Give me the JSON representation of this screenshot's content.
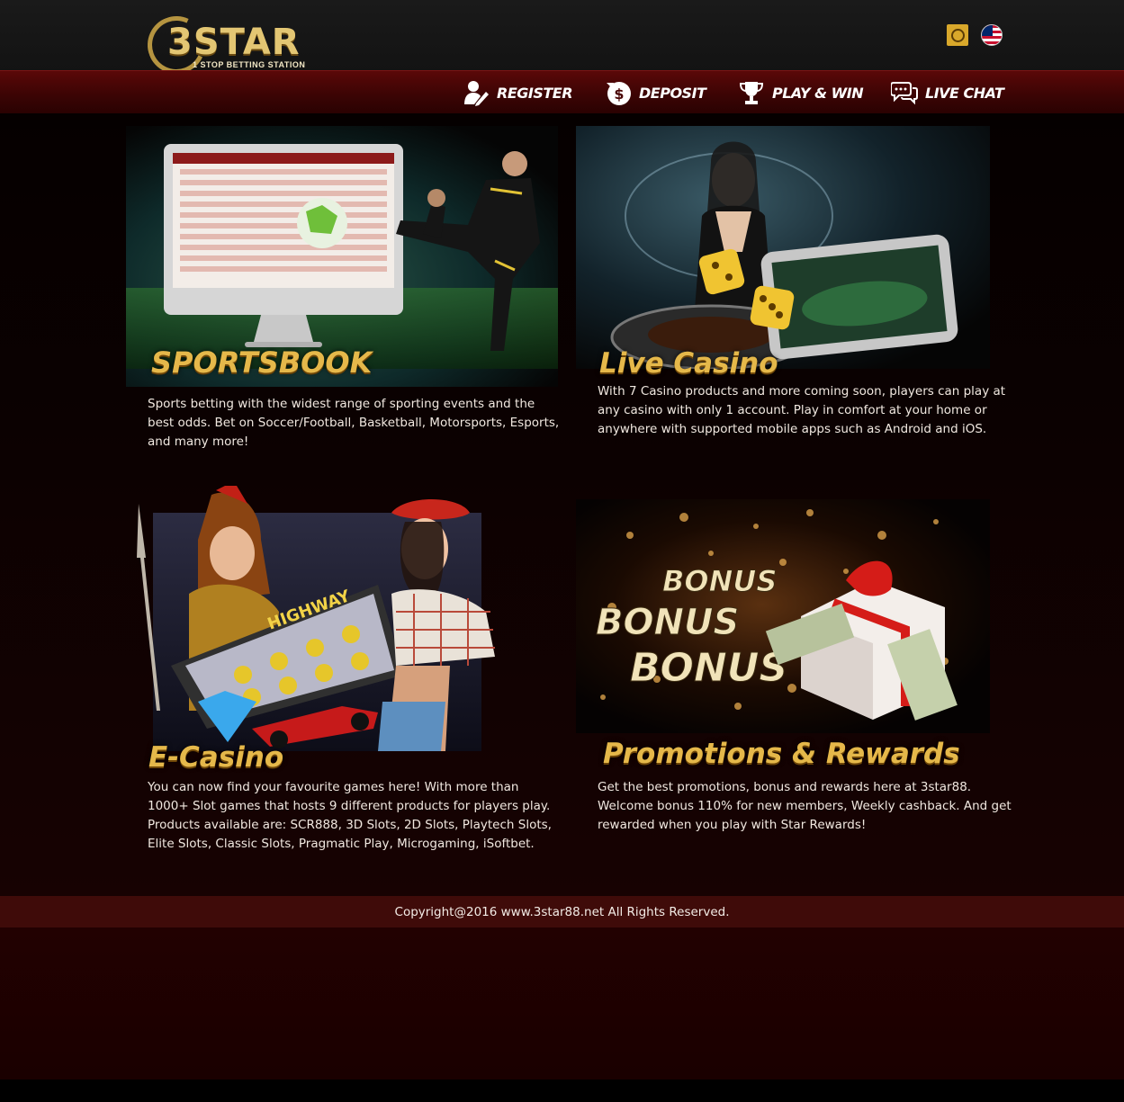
{
  "brand": {
    "logo_word": "3STAR",
    "tagline": "1 STOP BETTING STATION"
  },
  "languages": [
    {
      "name": "chinese-language-icon"
    },
    {
      "name": "malaysia-flag-icon"
    }
  ],
  "nav": {
    "items": [
      {
        "label": "REGISTER",
        "icon": "user-pen-icon"
      },
      {
        "label": "DEPOSIT",
        "icon": "money-bag-icon"
      },
      {
        "label": "PLAY & WIN",
        "icon": "trophy-icon"
      },
      {
        "label": "LIVE CHAT",
        "icon": "chat-bubbles-icon"
      }
    ]
  },
  "sections": {
    "sportsbook": {
      "title": "SPORTSBOOK",
      "text": "Sports betting with the widest range of sporting events and the best odds. Bet on Soccer/Football, Basketball, Motorsports, Esports, and many more!"
    },
    "live_casino": {
      "title": "Live Casino",
      "text": "With 7 Casino products and more coming soon, players can play at any casino with only 1 account. Play in comfort at your home or anywhere with supported mobile apps such as Android and iOS."
    },
    "ecasino": {
      "title": "E-Casino",
      "art_label": "HIGHWAY",
      "text": "You can now find your favourite games here! With more than 1000+ Slot games that hosts 9 different products for players play. Products available are: SCR888, 3D Slots, 2D Slots, Playtech Slots, Elite Slots, Classic Slots, Pragmatic Play, Microgaming, iSoftbet."
    },
    "promotions": {
      "title": "Promotions & Rewards",
      "art_words": [
        "BONUS",
        "BONUS",
        "BONUS"
      ],
      "text": "Get the best promotions, bonus and rewards here at 3star88. Welcome bonus 110% for new members, Weekly cashback. And get rewarded when you play with Star Rewards!"
    }
  },
  "footer": {
    "copyright": "Copyright@2016 www.3star88.net All Rights Reserved."
  },
  "colors": {
    "nav_bg": "#4a0606",
    "title_gold": "#e5b84a",
    "footer_bg": "#3f0b09"
  }
}
